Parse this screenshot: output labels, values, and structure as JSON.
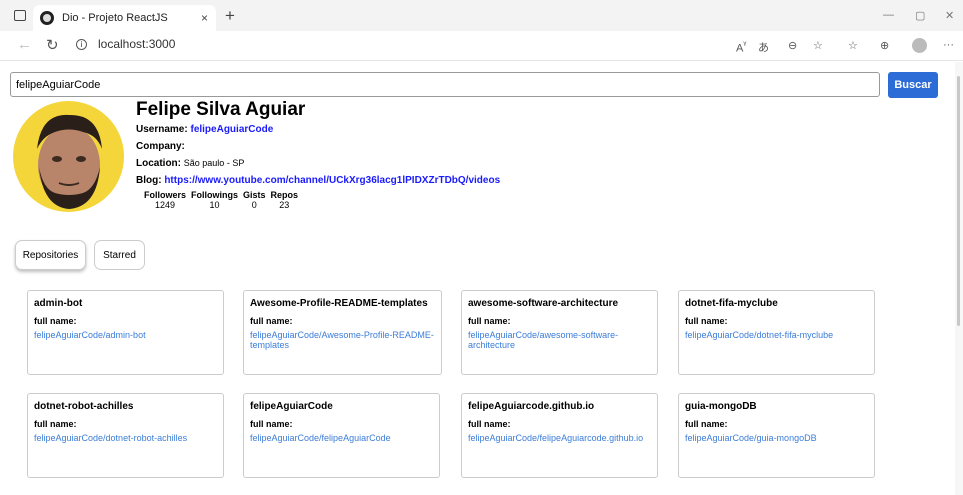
{
  "browser": {
    "tab_title": "Dio - Projeto ReactJS",
    "tab_close": "×",
    "new_tab": "+",
    "url": "localhost:3000",
    "win_min": "—",
    "win_max": "▢",
    "win_close": "✕"
  },
  "search": {
    "value": "felipeAguiarCode",
    "button": "Buscar"
  },
  "profile": {
    "name": "Felipe Silva Aguiar",
    "username_label": "Username:",
    "username": "felipeAguiarCode",
    "company_label": "Company:",
    "company": "",
    "location_label": "Location:",
    "location": "São paulo - SP",
    "blog_label": "Blog:",
    "blog": "https://www.youtube.com/channel/UCkXrg36lacg1lPIDXZrTDbQ/videos",
    "stats": [
      {
        "label": "Followers",
        "value": "1249"
      },
      {
        "label": "Followings",
        "value": "10"
      },
      {
        "label": "Gists",
        "value": "0"
      },
      {
        "label": "Repos",
        "value": "23"
      }
    ]
  },
  "tabs": {
    "repositories": "Repositories",
    "starred": "Starred"
  },
  "cards": [
    {
      "name": "admin-bot",
      "full_label": "full name:",
      "full": "felipeAguiarCode/admin-bot"
    },
    {
      "name": "Awesome-Profile-README-templates",
      "full_label": "full name:",
      "full": "felipeAguiarCode/Awesome-Profile-README-templates"
    },
    {
      "name": "awesome-software-architecture",
      "full_label": "full name:",
      "full": "felipeAguiarCode/awesome-software-architecture"
    },
    {
      "name": "dotnet-fifa-myclube",
      "full_label": "full name:",
      "full": "felipeAguiarCode/dotnet-fifa-myclube"
    },
    {
      "name": "dotnet-robot-achilles",
      "full_label": "full name:",
      "full": "felipeAguiarCode/dotnet-robot-achilles"
    },
    {
      "name": "felipeAguiarCode",
      "full_label": "full name:",
      "full": "felipeAguiarCode/felipeAguiarCode"
    },
    {
      "name": "felipeAguiarcode.github.io",
      "full_label": "full name:",
      "full": "felipeAguiarCode/felipeAguiarcode.github.io"
    },
    {
      "name": "guia-mongoDB",
      "full_label": "full name:",
      "full": "felipeAguiarCode/guia-mongoDB"
    }
  ]
}
